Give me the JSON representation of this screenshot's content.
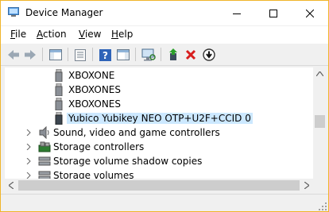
{
  "window": {
    "title": "Device Manager",
    "accent_border": "#f0b429"
  },
  "menu": [
    {
      "accel": "F",
      "rest": "ile"
    },
    {
      "accel": "A",
      "rest": "ction"
    },
    {
      "accel": "V",
      "rest": "iew"
    },
    {
      "accel": "H",
      "rest": "elp"
    }
  ],
  "toolbar": {
    "icons": [
      "back-arrow-icon",
      "forward-arrow-icon",
      "show-hide-console-tree-icon",
      "properties-icon",
      "help-icon",
      "action-pane-icon",
      "scan-hardware-changes-icon",
      "update-driver-icon",
      "uninstall-device-icon",
      "disable-device-icon"
    ]
  },
  "tree": {
    "devices": [
      {
        "label": "XBOXONE"
      },
      {
        "label": "XBOXONES"
      },
      {
        "label": "XBOXONES"
      },
      {
        "label": "Yubico Yubikey NEO OTP+U2F+CCID 0",
        "selected": true
      }
    ],
    "categories": [
      {
        "label": "Sound, video and game controllers",
        "icon": "speaker-icon"
      },
      {
        "label": "Storage controllers",
        "icon": "storage-controller-icon"
      },
      {
        "label": "Storage volume shadow copies",
        "icon": "drive-icon"
      },
      {
        "label": "Storage volumes",
        "icon": "drive-icon"
      }
    ],
    "selection_color": "#cce8ff"
  }
}
